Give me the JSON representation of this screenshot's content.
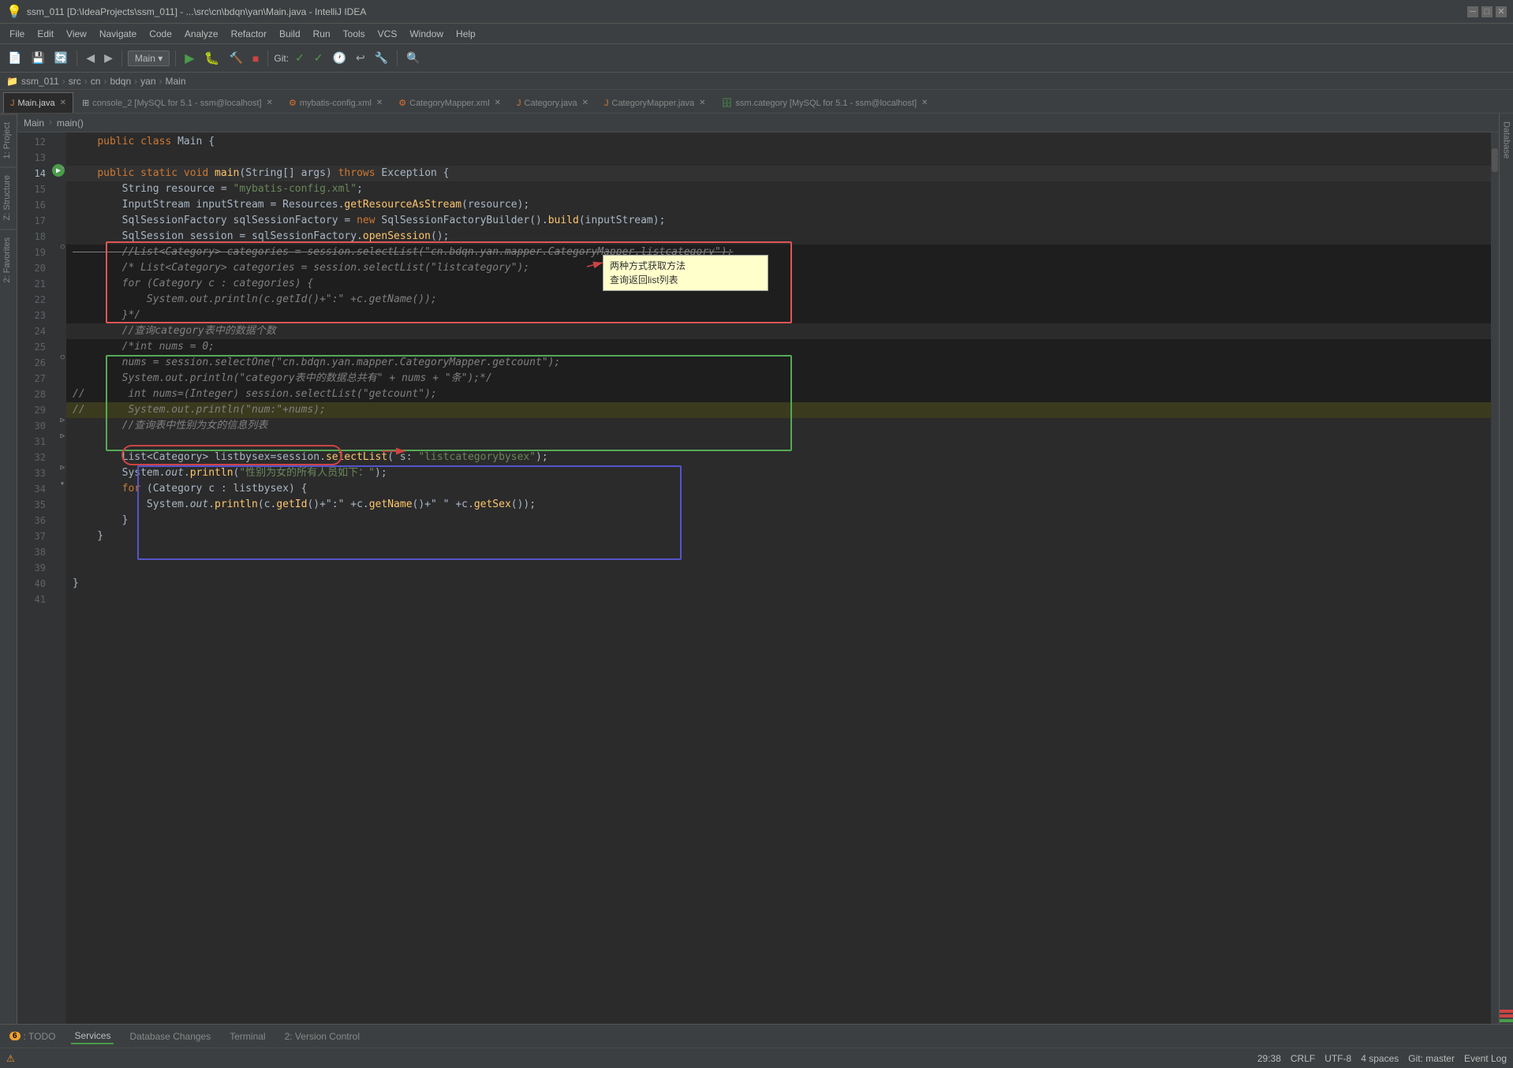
{
  "titleBar": {
    "title": "ssm_011 [D:\\IdeaProjects\\ssm_011] - ...\\src\\cn\\bdqn\\yan\\Main.java - IntelliJ IDEA",
    "minBtn": "─",
    "maxBtn": "□",
    "closeBtn": "✕"
  },
  "menuBar": {
    "items": [
      "File",
      "Edit",
      "View",
      "Navigate",
      "Code",
      "Analyze",
      "Refactor",
      "Build",
      "Run",
      "Tools",
      "VCS",
      "Window",
      "Help"
    ]
  },
  "toolbar": {
    "branchLabel": "Main",
    "gitLabel": "Git:",
    "searchPlaceholder": ""
  },
  "breadcrumb": {
    "parts": [
      "Main",
      ">",
      "main()"
    ]
  },
  "tabs": [
    {
      "label": "Main.java",
      "active": true,
      "icon": "java"
    },
    {
      "label": "console_2 [MySQL for 5.1 - ssm@localhost]",
      "active": false,
      "icon": "console"
    },
    {
      "label": "mybatis-config.xml",
      "active": false,
      "icon": "xml"
    },
    {
      "label": "CategoryMapper.xml",
      "active": false,
      "icon": "xml"
    },
    {
      "label": "Category.java",
      "active": false,
      "icon": "java"
    },
    {
      "label": "CategoryMapper.java",
      "active": false,
      "icon": "java"
    },
    {
      "label": "ssm.category [MySQL for 5.1 - ssm@localhost]",
      "active": false,
      "icon": "db"
    }
  ],
  "codeLines": [
    {
      "num": 12,
      "content": "    public class Main {",
      "type": "normal"
    },
    {
      "num": 13,
      "content": "",
      "type": "normal"
    },
    {
      "num": 14,
      "content": "    public static void main(String[] args) throws Exception {",
      "type": "run",
      "hasGutter": true
    },
    {
      "num": 15,
      "content": "        String resource = \"mybatis-config.xml\";",
      "type": "normal"
    },
    {
      "num": 16,
      "content": "        InputStream inputStream = Resources.getResourceAsStream(resource);",
      "type": "normal"
    },
    {
      "num": 17,
      "content": "        SqlSessionFactory sqlSessionFactory = new SqlSessionFactoryBuilder().build(inputStream);",
      "type": "normal"
    },
    {
      "num": 18,
      "content": "        SqlSession session = sqlSessionFactory.openSession();",
      "type": "normal"
    },
    {
      "num": 19,
      "content": "        //List<Category> categories = session.selectList(\"cn.bdqn.yan.mapper.CategoryMapper.listcategory\");",
      "type": "commented_strike"
    },
    {
      "num": 20,
      "content": "        /* List<Category> categories = session.selectList(\"listcategory\");",
      "type": "comment_block"
    },
    {
      "num": 21,
      "content": "        for (Category c : categories) {",
      "type": "comment_block"
    },
    {
      "num": 22,
      "content": "            System.out.println(c.getId()+\":\"+c.getName());",
      "type": "comment_block"
    },
    {
      "num": 23,
      "content": "        }*/",
      "type": "comment_block"
    },
    {
      "num": 24,
      "content": "        //查询category表中的数据个数",
      "type": "cn_comment"
    },
    {
      "num": 25,
      "content": "        /*int nums = 0;",
      "type": "comment_block2"
    },
    {
      "num": 26,
      "content": "        nums = session.selectOne(\"cn.bdqn.yan.mapper.CategoryMapper.getcount\");",
      "type": "comment_block2"
    },
    {
      "num": 27,
      "content": "        System.out.println(\"category表中的数据总共有\" + nums + \"条\");*/",
      "type": "comment_block2"
    },
    {
      "num": 28,
      "content": "//          int nums=(Integer) session.selectList(\"getcount\");",
      "type": "comment_block2"
    },
    {
      "num": 29,
      "content": "//          System.out.println(\"num:\"+nums);",
      "type": "comment_block2_yellow"
    },
    {
      "num": 30,
      "content": "        //查询表中性别为女的信息列表",
      "type": "cn_comment_circle"
    },
    {
      "num": 31,
      "content": "",
      "type": "normal"
    },
    {
      "num": 32,
      "content": "        List<Category> listbysex=session.selectList( s: \"listcategorybysex\");",
      "type": "blue_box"
    },
    {
      "num": 33,
      "content": "        System.out.println(\"性别为女的所有人员如下：\");",
      "type": "blue_box"
    },
    {
      "num": 34,
      "content": "        for (Category c : listbysex) {",
      "type": "blue_box"
    },
    {
      "num": 35,
      "content": "            System.out.println(c.getId()+\":\"+c.getName()+\" \"+c.getSex());",
      "type": "blue_box"
    },
    {
      "num": 36,
      "content": "        }",
      "type": "blue_box"
    },
    {
      "num": 37,
      "content": "    }",
      "type": "normal"
    },
    {
      "num": 38,
      "content": "",
      "type": "normal"
    },
    {
      "num": 39,
      "content": "",
      "type": "normal"
    },
    {
      "num": 40,
      "content": "}",
      "type": "normal"
    },
    {
      "num": 41,
      "content": "",
      "type": "normal"
    }
  ],
  "callout": {
    "line1": "两种方式获取方法",
    "line2": "查询返回list列表"
  },
  "verticalTabs": {
    "items": [
      "1: Project",
      "Z: Structure",
      "2: Favorites"
    ]
  },
  "rightPanel": {
    "items": [
      "Database"
    ]
  },
  "bottomTabs": {
    "items": [
      {
        "label": "6: TODO",
        "badge": "",
        "active": false
      },
      {
        "label": "Services",
        "active": false
      },
      {
        "label": "Database Changes",
        "active": false
      },
      {
        "label": "Terminal",
        "active": false
      },
      {
        "label": "2: Version Control",
        "active": false
      }
    ]
  },
  "statusBar": {
    "right": {
      "line": "29:38",
      "encoding": "CRLF",
      "charset": "UTF-8",
      "indent": "4 spaces",
      "branch": "Git: master",
      "eventLog": "Event Log"
    }
  }
}
